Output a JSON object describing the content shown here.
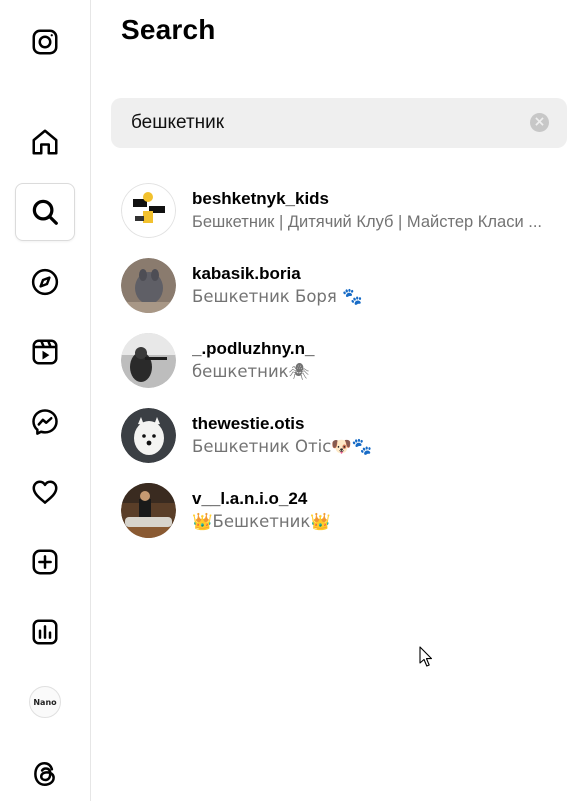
{
  "panel": {
    "title": "Search"
  },
  "search": {
    "value": "бешкетник",
    "placeholder": "Search",
    "clear_icon": "clear-icon"
  },
  "nav": {
    "items": [
      {
        "name": "instagram-logo",
        "icon": "instagram-icon"
      },
      {
        "name": "home",
        "icon": "home-icon"
      },
      {
        "name": "search",
        "icon": "search-icon",
        "active": true
      },
      {
        "name": "explore",
        "icon": "compass-icon"
      },
      {
        "name": "reels",
        "icon": "reels-icon"
      },
      {
        "name": "messages",
        "icon": "messenger-icon"
      },
      {
        "name": "notifications",
        "icon": "heart-icon"
      },
      {
        "name": "create",
        "icon": "plus-square-icon"
      },
      {
        "name": "dashboard",
        "icon": "bar-chart-icon"
      },
      {
        "name": "profile",
        "icon": "nano-avatar",
        "label": "Nano"
      },
      {
        "name": "threads",
        "icon": "threads-icon"
      }
    ]
  },
  "results": [
    {
      "username": "beshketnyk_kids",
      "subtitle": "Бешкетник | Дитячий Клуб | Майстер Класи ..."
    },
    {
      "username": "kabasik.boria",
      "subtitle": "Бешкетник Боря 🐾"
    },
    {
      "username": "_.podluzhny.n_",
      "subtitle": "бешкетник🕷"
    },
    {
      "username": "thewestie.otis",
      "subtitle": "Бешкетник Отіс🐶🐾"
    },
    {
      "username": "v__l.a.n.i.o_24",
      "subtitle": "👑Бешкетник👑"
    }
  ],
  "colors": {
    "text_primary": "#000000",
    "text_secondary": "#737373",
    "search_bg": "#efefef",
    "border": "#dbdbdb"
  }
}
